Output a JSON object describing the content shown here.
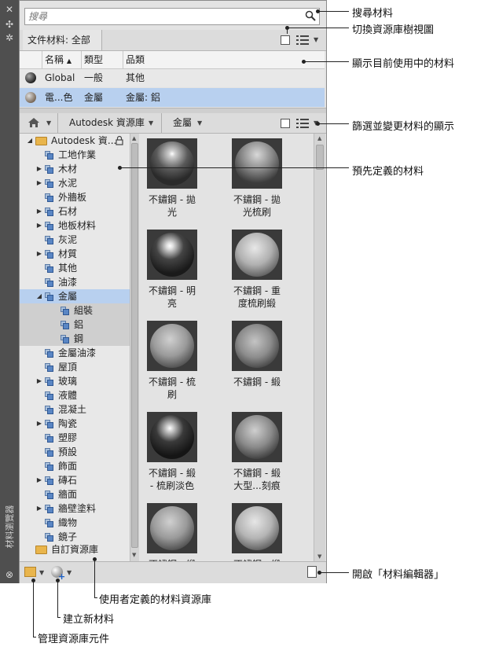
{
  "search": {
    "placeholder": "搜尋"
  },
  "sidebar": {
    "title": "材料瀏覽器",
    "close_glyph": "✕",
    "pin_glyph": "✣",
    "props_glyph": "✲",
    "bottom_glyph": "⊗"
  },
  "doc_bar": {
    "label": "文件材料: 全部"
  },
  "table": {
    "columns": [
      "名稱",
      "類型",
      "品類"
    ],
    "rows": [
      {
        "name": "Global",
        "type": "一般",
        "category": "其他",
        "selected": false
      },
      {
        "name": "電...色",
        "type": "金屬",
        "category": "金屬: 鋁",
        "selected": true
      }
    ]
  },
  "breadcrumb": {
    "home_icon": "home-icon",
    "items": [
      "Autodesk 資源庫",
      "金屬"
    ]
  },
  "tree": {
    "root": "Autodesk 資...",
    "items": [
      {
        "label": "工地作業",
        "expandable": false
      },
      {
        "label": "木材",
        "expandable": true
      },
      {
        "label": "水泥",
        "expandable": true
      },
      {
        "label": "外牆板",
        "expandable": false
      },
      {
        "label": "石材",
        "expandable": true
      },
      {
        "label": "地板材料",
        "expandable": true
      },
      {
        "label": "灰泥",
        "expandable": false
      },
      {
        "label": "材質",
        "expandable": true
      },
      {
        "label": "其他",
        "expandable": false
      },
      {
        "label": "油漆",
        "expandable": false
      },
      {
        "label": "金屬",
        "expandable": true,
        "expanded": true,
        "selected": true
      },
      {
        "label": "組裝",
        "child": true
      },
      {
        "label": "鋁",
        "child": true
      },
      {
        "label": "鋼",
        "child": true
      },
      {
        "label": "金屬油漆",
        "expandable": false
      },
      {
        "label": "屋頂",
        "expandable": false
      },
      {
        "label": "玻璃",
        "expandable": true
      },
      {
        "label": "液體",
        "expandable": false
      },
      {
        "label": "混凝土",
        "expandable": false
      },
      {
        "label": "陶瓷",
        "expandable": true
      },
      {
        "label": "塑膠",
        "expandable": false
      },
      {
        "label": "預設",
        "expandable": false
      },
      {
        "label": "飾面",
        "expandable": false
      },
      {
        "label": "磚石",
        "expandable": true
      },
      {
        "label": "牆面",
        "expandable": false
      },
      {
        "label": "牆壁塗料",
        "expandable": true
      },
      {
        "label": "織物",
        "expandable": false
      },
      {
        "label": "鏡子",
        "expandable": false
      }
    ],
    "custom_library": "自訂資源庫"
  },
  "materials": [
    {
      "line1": "不鏽鋼 - 拋",
      "line2": "光"
    },
    {
      "line1": "不鏽鋼 - 拋",
      "line2": "光梳刷"
    },
    {
      "line1": "不鏽鋼 - 明",
      "line2": "亮"
    },
    {
      "line1": "不鏽鋼 - 重",
      "line2": "度梳刷緞"
    },
    {
      "line1": "不鏽鋼 - 梳",
      "line2": "刷"
    },
    {
      "line1": "不鏽鋼 - 緞",
      "line2": ""
    },
    {
      "line1": "不鏽鋼 - 緞",
      "line2": "- 梳刷淡色"
    },
    {
      "line1": "不鏽鋼 - 緞",
      "line2": "大型...刻痕"
    },
    {
      "line1": "不鏽鋼 - 緞",
      "line2": ""
    },
    {
      "line1": "不鏽鋼 - 緞",
      "line2": ""
    }
  ],
  "callouts": {
    "search": "搜尋材料",
    "toggle_tree": "切換資源庫樹視圖",
    "in_use": "顯示目前使用中的材料",
    "filter": "篩選並變更材料的顯示",
    "predefined": "預先定義的材料",
    "open_editor": "開啟「材料編輯器」",
    "user_library": "使用者定義的材料資源庫",
    "create_new": "建立新材料",
    "manage_library": "管理資源庫元件"
  },
  "colors": {
    "selection": "#b8d0ef",
    "panel": "#e3e3e3",
    "sidebar": "#4f4f4f",
    "folder": "#e9b54c"
  }
}
